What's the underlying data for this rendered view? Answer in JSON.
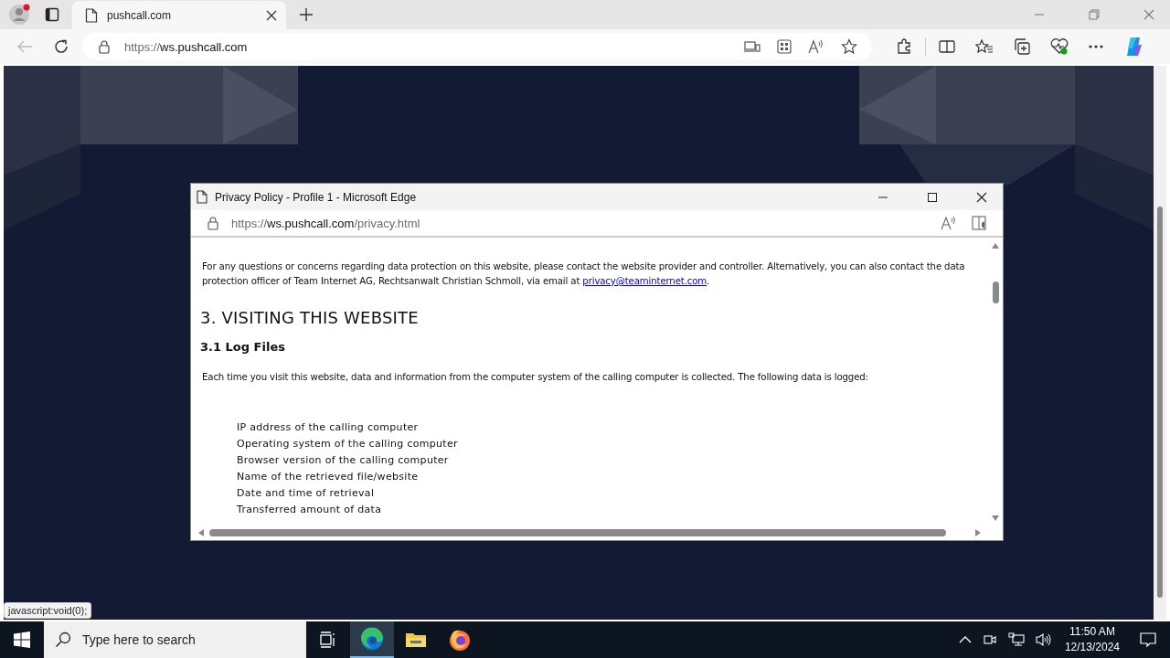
{
  "browser": {
    "tab": {
      "title": "pushcall.com",
      "selected": true
    },
    "address": {
      "scheme": "https://",
      "host": "ws.pushcall.com"
    }
  },
  "popup": {
    "title": "Privacy Policy - Profile 1 - Microsoft Edge",
    "address": {
      "scheme": "https://",
      "host": "ws.pushcall.com",
      "path": "/privacy.html"
    },
    "intro": {
      "text": "For any questions or concerns regarding data protection on this website, please contact the website provider and controller. Alternatively, you can also contact the data protection officer of Team Internet AG, Rechtsanwalt Christian Schmoll, via email at ",
      "link": "privacy@teaminternet.com",
      "after": "."
    },
    "heading": "3. VISITING THIS WEBSITE",
    "subheading": "3.1 Log Files",
    "paragraph": "Each time you visit this website, data and information from the computer system of the calling computer is collected. The following data is logged:",
    "list": [
      "IP address of the calling computer",
      "Operating system of the calling computer",
      "Browser version of the calling computer",
      "Name of the retrieved file/website",
      "Date and time of retrieval",
      "Transferred amount of data"
    ]
  },
  "status_text": "javascript:void(0);",
  "taskbar": {
    "search_placeholder": "Type here to search",
    "apps": [
      {
        "kind": "task-view",
        "selected": false
      },
      {
        "kind": "edge",
        "selected": true
      },
      {
        "kind": "explorer",
        "selected": false
      },
      {
        "kind": "firefox",
        "selected": false
      }
    ],
    "time": "11:50 AM",
    "date": "12/13/2024"
  }
}
